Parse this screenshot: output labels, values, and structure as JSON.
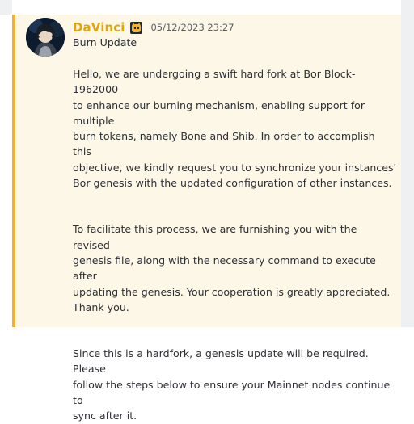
{
  "message": {
    "author": "DaVinci",
    "timestamp": "05/12/2023 23:27",
    "role_icon": "cat-emoji-icon",
    "subject": "Burn Update",
    "paragraphs": [
      "Hello, we are undergoing a swift hard fork at Bor Block- 1962000\nto enhance our burning mechanism, enabling support for multiple\nburn tokens, namely Bone and Shib. In order to accomplish this\nobjective, we kindly request you to synchronize your  instances'\nBor genesis with the updated configuration of other instances.",
      "To facilitate this process, we are furnishing you with the revised\ngenesis file, along with the necessary command to execute after\nupdating the genesis. Your cooperation is greatly appreciated.\nThank you.",
      "Since this is a hardfork, a genesis update will be required. Please\nfollow the steps below to ensure your Mainnet nodes continue to\nsync after it."
    ]
  },
  "colors": {
    "author": "#e1a60a",
    "highlight_bar": "#f0b132",
    "highlight_bg": "#fdf7e8",
    "text": "#2e3035",
    "timestamp": "#5c5e66"
  }
}
